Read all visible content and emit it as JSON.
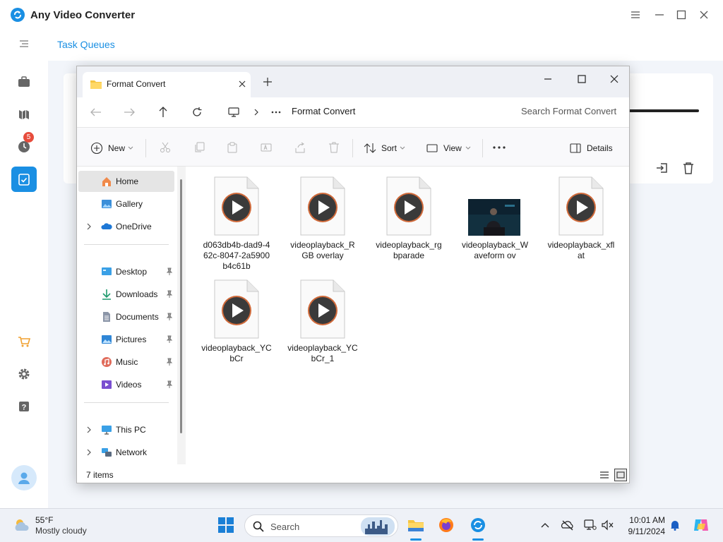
{
  "app": {
    "title": "Any Video Converter",
    "task_queues_label": "Task Queues",
    "badge_count": "5",
    "colors": {
      "accent": "#1a8fe3",
      "badge": "#e74c3c"
    }
  },
  "explorer": {
    "tab_title": "Format Convert",
    "breadcrumb": "Format Convert",
    "search_placeholder": "Search Format Convert",
    "toolbar": {
      "new_label": "New",
      "sort_label": "Sort",
      "view_label": "View",
      "details_label": "Details"
    },
    "nav": {
      "home": "Home",
      "gallery": "Gallery",
      "onedrive": "OneDrive",
      "desktop": "Desktop",
      "downloads": "Downloads",
      "documents": "Documents",
      "pictures": "Pictures",
      "music": "Music",
      "videos": "Videos",
      "this_pc": "This PC",
      "network": "Network"
    },
    "files": [
      {
        "name": "d063db4b-dad9-462c-8047-2a5900b4c61b"
      },
      {
        "name": "videoplayback_RGB overlay"
      },
      {
        "name": "videoplayback_rgbparade"
      },
      {
        "name": "videoplayback_Waveform ov"
      },
      {
        "name": "videoplayback_xflat"
      },
      {
        "name": "videoplayback_YCbCr"
      },
      {
        "name": "videoplayback_YCbCr_1"
      }
    ],
    "status": "7 items"
  },
  "taskbar": {
    "weather_temp": "55°F",
    "weather_desc": "Mostly cloudy",
    "search_label": "Search",
    "time": "10:01 AM",
    "date": "9/11/2024"
  }
}
